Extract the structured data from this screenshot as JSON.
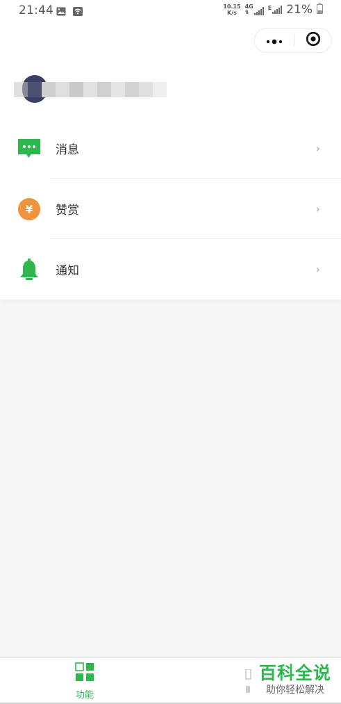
{
  "status_bar": {
    "time": "21:44",
    "net_speed_value": "10.15",
    "net_speed_unit": "K/s",
    "network_4g": "4G",
    "network_e": "E",
    "battery": "21%"
  },
  "header": {
    "username": "",
    "capsule": {
      "more_icon": "more-dots-icon",
      "close_icon": "target-icon"
    }
  },
  "menu": {
    "items": [
      {
        "label": "消息",
        "icon": "message-icon",
        "color": "#2db84d"
      },
      {
        "label": "赞赏",
        "icon": "yuan-coin-icon",
        "color": "#f0943a"
      },
      {
        "label": "通知",
        "icon": "bell-icon",
        "color": "#2db84d"
      }
    ],
    "chevron": "›"
  },
  "tabbar": {
    "tabs": [
      {
        "label": "功能",
        "icon": "grid-icon",
        "active": true
      }
    ],
    "active_color": "#2db84d"
  },
  "watermark": {
    "title": "百科全说",
    "subtitle": "助你轻松解决"
  },
  "colors": {
    "accent": "#2db84d",
    "reward": "#f0943a"
  }
}
